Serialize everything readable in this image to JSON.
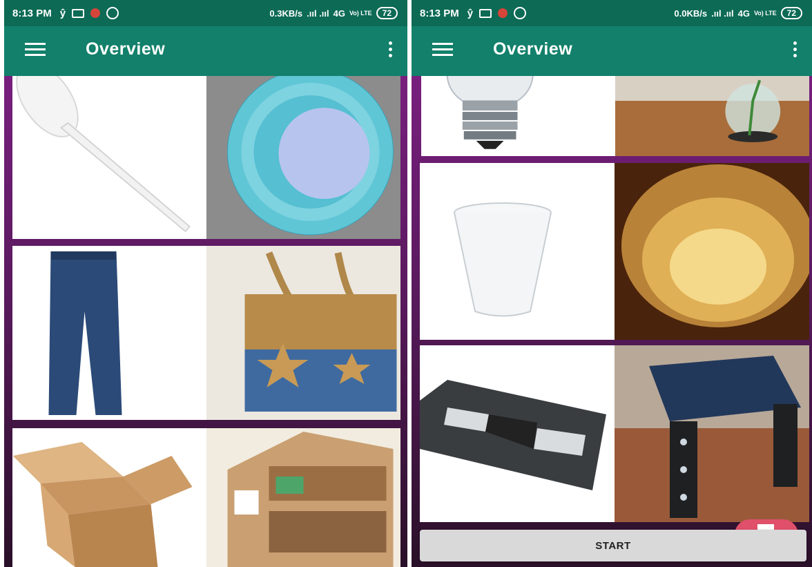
{
  "left_phone": {
    "status": {
      "time": "8:13 PM",
      "speed": "0.3KB/s",
      "network": "4G",
      "volte": "Vo) LTE",
      "battery": "72"
    },
    "appbar": {
      "title": "Overview"
    }
  },
  "right_phone": {
    "status": {
      "time": "8:13 PM",
      "speed": "0.0KB/s",
      "network": "4G",
      "volte": "Vo) LTE",
      "battery": "72"
    },
    "appbar": {
      "title": "Overview"
    },
    "start_button": "START"
  },
  "icons": {
    "menu": "hamburger-menu-icon",
    "overflow": "more-vert-icon",
    "fab": "mail-icon"
  },
  "colors": {
    "status_bar": "#0c6a55",
    "app_bar": "#12806a",
    "background_top": "#7a1f80",
    "background_bottom": "#2a1028",
    "start_button": "#d9d9d9",
    "fab": "#e0506a"
  },
  "tiles_left": [
    {
      "item": "plastic spoon",
      "craft": "spoon flower mirror"
    },
    {
      "item": "jeans",
      "craft": "denim star tote bag"
    },
    {
      "item": "cardboard box",
      "craft": "cardboard dollhouse"
    }
  ],
  "tiles_right": [
    {
      "item": "light bulb",
      "craft": "light bulb planter"
    },
    {
      "item": "plastic cup",
      "craft": "cup lamp"
    },
    {
      "item": "VHS cassette",
      "craft": "cassette table"
    }
  ]
}
